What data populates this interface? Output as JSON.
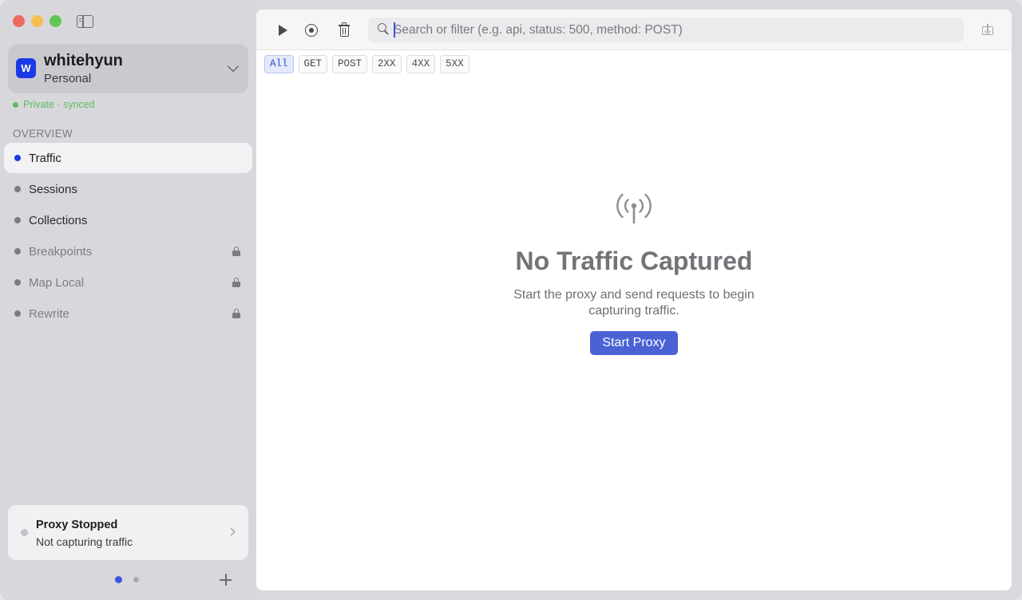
{
  "workspace": {
    "avatar_letter": "W",
    "name": "whitehyun",
    "plan": "Personal",
    "sync_status": "Private · synced"
  },
  "sidebar": {
    "section_header": "OVERVIEW",
    "items": [
      {
        "label": "Traffic",
        "active": true,
        "locked": false
      },
      {
        "label": "Sessions",
        "active": false,
        "locked": false
      },
      {
        "label": "Collections",
        "active": false,
        "locked": false
      },
      {
        "label": "Breakpoints",
        "active": false,
        "locked": true
      },
      {
        "label": "Map Local",
        "active": false,
        "locked": true
      },
      {
        "label": "Rewrite",
        "active": false,
        "locked": true
      }
    ]
  },
  "proxy_status": {
    "title": "Proxy Stopped",
    "subtitle": "Not capturing traffic"
  },
  "toolbar": {
    "icons": [
      "play-icon",
      "record-icon",
      "trash-icon",
      "export-icon"
    ],
    "search_placeholder": "Search or filter (e.g. api, status: 500, method: POST)",
    "search_value": ""
  },
  "filters": [
    "All",
    "GET",
    "POST",
    "2XX",
    "4XX",
    "5XX"
  ],
  "active_filter": "All",
  "empty_state": {
    "icon": "antenna-icon",
    "title": "No Traffic Captured",
    "description": "Start the proxy and send requests to begin capturing traffic.",
    "button_label": "Start Proxy"
  },
  "colors": {
    "accent": "#1a3ae6",
    "button": "#4a62d4",
    "synced": "#5cbb62"
  }
}
